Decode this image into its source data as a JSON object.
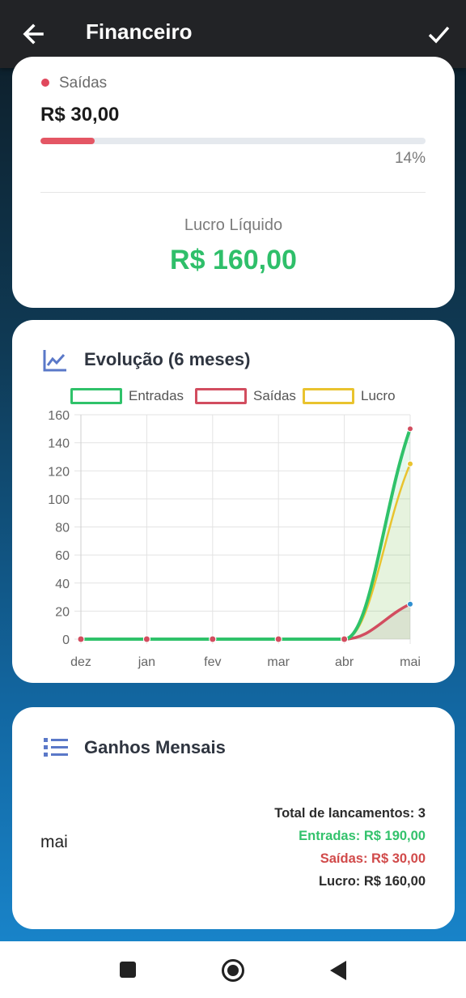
{
  "appbar": {
    "title": "Financeiro"
  },
  "summary": {
    "saidas_label": "Saídas",
    "saidas_value": "R$ 30,00",
    "saidas_progress": 14,
    "saidas_pct": "14%",
    "lucro_label": "Lucro Líquido",
    "lucro_value": "R$ 160,00"
  },
  "evolucao": {
    "title": "Evolução (6 meses)",
    "legend": {
      "entradas": "Entradas",
      "saidas": "Saídas",
      "lucro": "Lucro"
    }
  },
  "chart_data": {
    "type": "line",
    "categories": [
      "dez",
      "jan",
      "fev",
      "mar",
      "abr",
      "mai"
    ],
    "ylim": [
      0,
      160
    ],
    "yticks": [
      0,
      20,
      40,
      60,
      80,
      100,
      120,
      140,
      160
    ],
    "grid": true,
    "legend_position": "top",
    "series": [
      {
        "name": "Entradas",
        "color": "#2fc26a",
        "values": [
          0,
          0,
          0,
          0,
          0,
          150
        ]
      },
      {
        "name": "Saídas",
        "color": "#d24d5f",
        "values": [
          0,
          0,
          0,
          0,
          0,
          25
        ]
      },
      {
        "name": "Lucro",
        "color": "#e9c32e",
        "values": [
          0,
          0,
          0,
          0,
          0,
          125
        ]
      }
    ]
  },
  "ganhos": {
    "title": "Ganhos Mensais",
    "month": "mai",
    "total": "Total de lancamentos: 3",
    "entradas": "Entradas: R$ 190,00",
    "saidas": "Saídas: R$ 30,00",
    "lucro": "Lucro: R$ 160,00"
  },
  "icons": {
    "back": "arrow-left-icon",
    "confirm": "check-icon",
    "chart": "chart-line-icon",
    "list": "list-icon"
  }
}
